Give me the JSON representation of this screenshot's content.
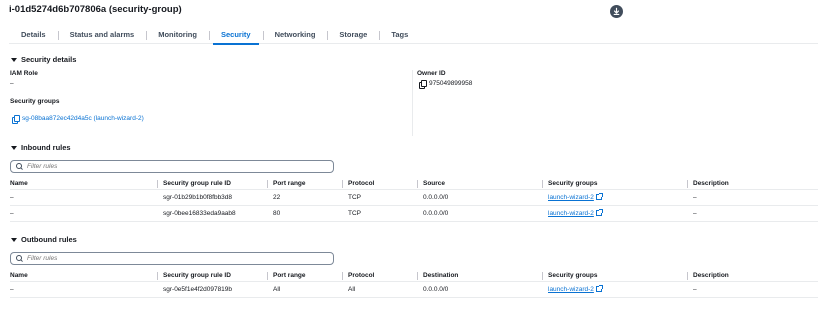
{
  "header": {
    "title": "i-01d5274d6b707806a (security-group)"
  },
  "tabs": [
    {
      "label": "Details"
    },
    {
      "label": "Status and alarms"
    },
    {
      "label": "Monitoring"
    },
    {
      "label": "Security",
      "active": true
    },
    {
      "label": "Networking"
    },
    {
      "label": "Storage"
    },
    {
      "label": "Tags"
    }
  ],
  "security_details": {
    "heading": "Security details",
    "iam_role_label": "IAM Role",
    "iam_role_value": "–",
    "owner_id_label": "Owner ID",
    "owner_id_value": "975049899958",
    "security_groups_label": "Security groups",
    "security_group_link": "sg-08baa872ec42d4a5c (launch-wizard-2)"
  },
  "inbound": {
    "heading": "Inbound rules",
    "filter_placeholder": "Filter rules",
    "columns": [
      "Name",
      "Security group rule ID",
      "Port range",
      "Protocol",
      "Source",
      "Security groups",
      "Description"
    ],
    "rows": [
      {
        "name": "–",
        "rule_id": "sgr-01b29b1b0f8fbb3d8",
        "port": "22",
        "protocol": "TCP",
        "source": "0.0.0.0/0",
        "sg": "launch-wizard-2",
        "desc": "–"
      },
      {
        "name": "–",
        "rule_id": "sgr-0bee16833eda9aab8",
        "port": "80",
        "protocol": "TCP",
        "source": "0.0.0.0/0",
        "sg": "launch-wizard-2",
        "desc": "–"
      }
    ]
  },
  "outbound": {
    "heading": "Outbound rules",
    "filter_placeholder": "Filter rules",
    "columns": [
      "Name",
      "Security group rule ID",
      "Port range",
      "Protocol",
      "Destination",
      "Security groups",
      "Description"
    ],
    "rows": [
      {
        "name": "–",
        "rule_id": "sgr-0e5f1e4f2d097819b",
        "port": "All",
        "protocol": "All",
        "source": "0.0.0.0/0",
        "sg": "launch-wizard-2",
        "desc": "–"
      }
    ]
  },
  "colors": {
    "link": "#0972d3",
    "text": "#16191f",
    "border": "#e9ebed"
  }
}
